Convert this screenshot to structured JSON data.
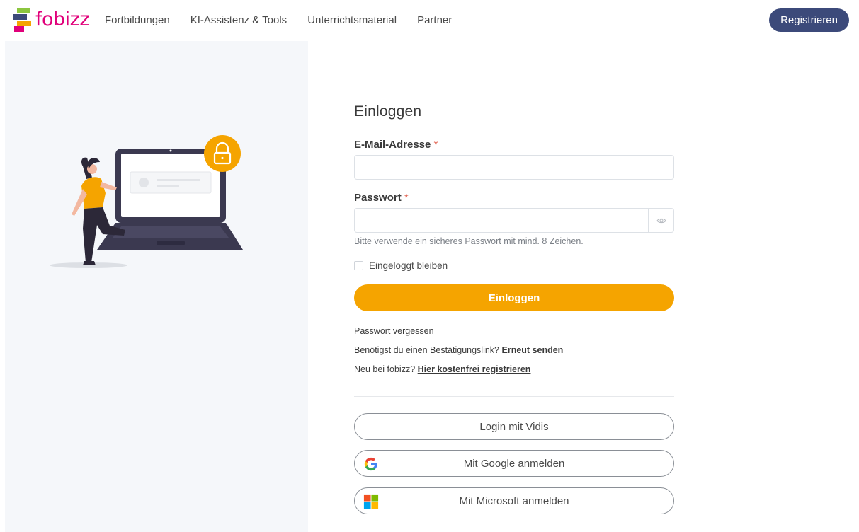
{
  "header": {
    "logo_text": "fobizz",
    "nav": [
      {
        "label": "Fortbildungen"
      },
      {
        "label": "KI-Assistenz & Tools"
      },
      {
        "label": "Unterrichtsmaterial"
      },
      {
        "label": "Partner"
      }
    ],
    "register_label": "Registrieren"
  },
  "form": {
    "title": "Einloggen",
    "email_label": "E-Mail-Adresse",
    "password_label": "Passwort",
    "required_mark": "*",
    "email_value": "",
    "password_value": "",
    "password_hint": "Bitte verwende ein sicheres Passwort mit mind. 8 Zeichen.",
    "remember_label": "Eingeloggt bleiben",
    "login_label": "Einloggen",
    "forgot_label": "Passwort vergessen",
    "confirm_text": "Benötigst du einen Bestätigungslink?",
    "confirm_link": "Erneut senden",
    "new_text": "Neu bei fobizz?",
    "new_link": "Hier kostenfrei registrieren"
  },
  "sso": {
    "vidis_label": "Login mit Vidis",
    "google_label": "Mit Google anmelden",
    "microsoft_label": "Mit Microsoft anmelden"
  },
  "colors": {
    "accent": "#f5a400",
    "brand_dark": "#3c4a7a",
    "brand_pink": "#e0007a",
    "required": "#e05a47"
  },
  "icons": {
    "eye": "eye-icon",
    "google": "google-icon",
    "microsoft": "microsoft-icon",
    "lock": "lock-icon"
  }
}
